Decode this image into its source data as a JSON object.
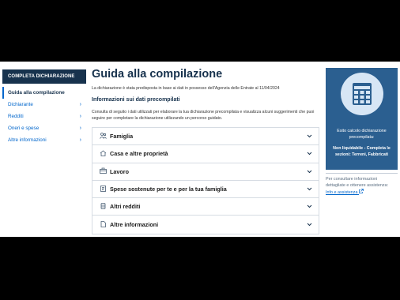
{
  "sidebar": {
    "header": "COMPLETA DICHIARAZIONE",
    "items": [
      {
        "label": "Guida alla compilazione",
        "active": true
      },
      {
        "label": "Dichiarante"
      },
      {
        "label": "Redditi"
      },
      {
        "label": "Oneri e spese"
      },
      {
        "label": "Altre informazioni"
      }
    ],
    "chevron": "›"
  },
  "main": {
    "title": "Guida alla compilazione",
    "intro": "La dichiarazione è stata predisposta in base ai dati in possesso dell'Agenzia delle Entrate al 11/04/2024",
    "section_title": "Informazioni sui dati precompilati",
    "description": "Consulta di seguito i dati utilizzati per elaborare la tua dichiarazione precompilata e visualizza alcuni suggerimenti che puoi seguire per completare la dichiarazione utilizzando un percorso guidato.",
    "accordion": [
      {
        "label": "Famiglia",
        "icon": "family-icon"
      },
      {
        "label": "Casa e altre proprietà",
        "icon": "house-icon"
      },
      {
        "label": "Lavoro",
        "icon": "briefcase-icon"
      },
      {
        "label": "Spese sostenute per te e per la tua famiglia",
        "icon": "receipt-icon"
      },
      {
        "label": "Altri redditi",
        "icon": "coins-icon"
      },
      {
        "label": "Altre informazioni",
        "icon": "document-icon"
      }
    ],
    "chevron": "⌄"
  },
  "panel": {
    "icon": "calculator-icon",
    "label": "Esito calcolo dichiarazione precompilata:",
    "status": "Non liquidabile - Completa le sezioni: Terreni, Fabbricati",
    "bg_color": "#2b5f90"
  },
  "help": {
    "text": "Per consultare informazioni dettagliate e ottenere assistenza:",
    "link": "Info e assistenza",
    "link_icon": "external-link-icon"
  },
  "colors": {
    "accent": "#0066cc",
    "dark": "#17324d"
  }
}
